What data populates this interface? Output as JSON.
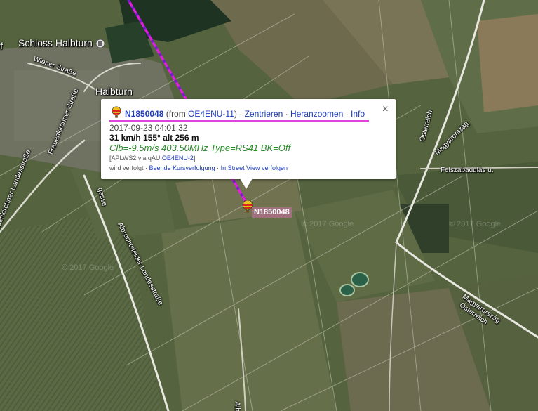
{
  "map": {
    "labels": {
      "town_castle": "Schloss Halbturn",
      "town": "Halbturn",
      "edge_text": "of",
      "wiener_strasse": "Wiener Straße",
      "frauenkirchner_strasse": "Frauenkirchner Straße",
      "frauenkirchner_landesstrasse": "Frauenkirchner Landesstraße",
      "albrechtsfelder_landesstrasse": "Albrechtsfelder Landesstraße",
      "gasse": "gasse",
      "oesterreich_top": "Österreich",
      "magyarorszag_top": "Magyarország",
      "felszabadulas": "Felszabadulás u.",
      "magyarorszag_bottom": "Magyarország",
      "oesterreich_bottom": "Österreich",
      "albre": "Albre"
    },
    "watermark": "© 2017 Google",
    "colors": {
      "track": "#e01ee0",
      "track_dash": "#7a1ad0"
    }
  },
  "marker": {
    "label": "N1850048",
    "icon": "balloon-icon"
  },
  "popup": {
    "callsign": "N1850048",
    "from_prefix": "(from ",
    "from_station": "OE4ENU-11",
    "from_suffix": ")",
    "sep": " · ",
    "link_center": "Zentrieren",
    "link_zoom": "Heranzoomen",
    "link_info": "Info",
    "timestamp": "2017-09-23 04:01:32",
    "motion": "31 km/h 155° alt 256 m",
    "comment": "Clb=-9.5m/s 403.50MHz Type=RS41 BK=Off",
    "path_prefix": "[APLWS2 via qAU,",
    "path_station": "OE4ENU-2",
    "path_suffix": "]",
    "tracked_text": "wird verfolgt · ",
    "link_stop_tracking": "Beende Kursverfolgung",
    "link_streetview": "In Street View verfolgen",
    "close_glyph": "×"
  }
}
